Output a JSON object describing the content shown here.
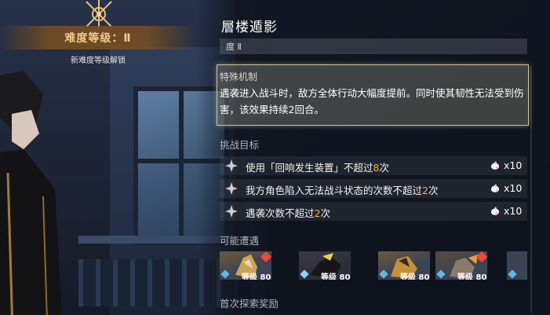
{
  "difficulty": {
    "label": "难度等级：Ⅱ",
    "unlock_note": "新难度等级解锁"
  },
  "panel": {
    "title": "層楼遁影",
    "level_tab": "度 Ⅱ"
  },
  "mechanic": {
    "heading": "特殊机制",
    "text": "遇袭进入战斗时，敌方全体行动大幅度提前。同时使其韧性无法受到伤害，该效果持续2回合。"
  },
  "objectives": {
    "heading": "挑战目标",
    "items": [
      {
        "prefix": "使用「回响发生装置」不超过",
        "num": "8",
        "suffix": "次",
        "reward": "x10"
      },
      {
        "prefix": "我方角色陷入无法战斗状态的次数不超过",
        "num": "2",
        "suffix": "次",
        "reward": "x10"
      },
      {
        "prefix": "遇袭次数不超过",
        "num": "2",
        "suffix": "次",
        "reward": "x10"
      }
    ]
  },
  "encounters": {
    "heading": "可能遭遇",
    "cards": [
      {
        "level": "等级 80",
        "element": "#5fb8e6"
      },
      {
        "level": "等级 80",
        "element": "#8fd3f5"
      },
      {
        "level": "等级 80",
        "element": "#5fb8e6"
      },
      {
        "level": "等级 80",
        "element": "#5fb8e6"
      },
      {
        "level": "",
        "element": "#5fb8e6"
      }
    ]
  },
  "first_reward": {
    "heading": "首次探索奖励"
  },
  "colors": {
    "highlight": "#f3b14e",
    "banner": "#7a5020"
  }
}
